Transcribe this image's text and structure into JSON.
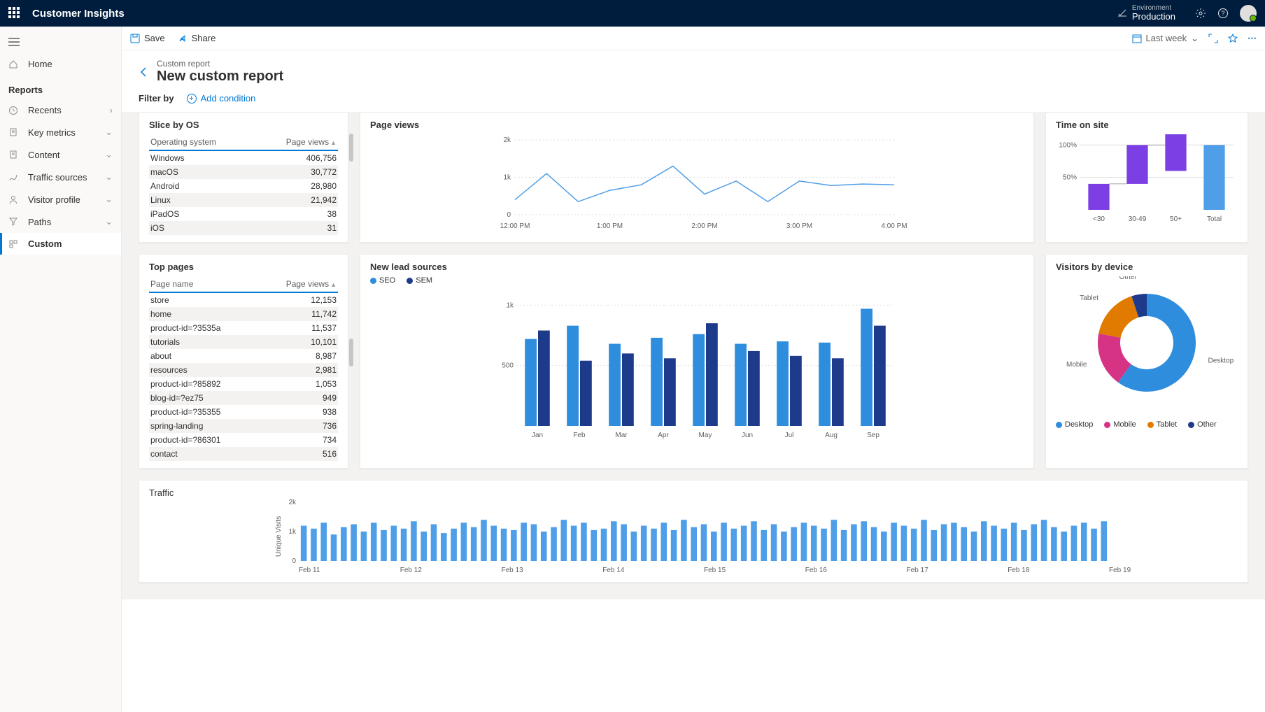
{
  "topbar": {
    "app_title": "Customer Insights",
    "env_label": "Environment",
    "env_value": "Production"
  },
  "sidebar": {
    "home": "Home",
    "section": "Reports",
    "items": [
      {
        "label": "Recents",
        "icon": "clock",
        "chev": "right"
      },
      {
        "label": "Key metrics",
        "icon": "document",
        "chev": "down"
      },
      {
        "label": "Content",
        "icon": "document",
        "chev": "down"
      },
      {
        "label": "Traffic sources",
        "icon": "routes",
        "chev": "down"
      },
      {
        "label": "Visitor profile",
        "icon": "person",
        "chev": "down"
      },
      {
        "label": "Paths",
        "icon": "funnel",
        "chev": "down"
      },
      {
        "label": "Custom",
        "icon": "custom",
        "selected": true
      }
    ]
  },
  "cmdbar": {
    "save": "Save",
    "share": "Share",
    "date_range": "Last week"
  },
  "page": {
    "crumb": "Custom report",
    "title": "New custom report",
    "filter_label": "Filter by",
    "add_condition": "Add condition"
  },
  "cards": {
    "slice_by_os": {
      "title": "Slice by OS",
      "col1": "Operating system",
      "col2": "Page views"
    },
    "page_views": {
      "title": "Page views"
    },
    "time_on_site": {
      "title": "Time on site"
    },
    "top_pages": {
      "title": "Top pages",
      "col1": "Page name",
      "col2": "Page views"
    },
    "new_lead_sources": {
      "title": "New lead sources",
      "legend_seo": "SEO",
      "legend_sem": "SEM"
    },
    "visitors_by_device": {
      "title": "Visitors by device",
      "l_desktop": "Desktop",
      "l_mobile": "Mobile",
      "l_tablet": "Tablet",
      "l_other": "Other"
    },
    "traffic": {
      "title": "Traffic",
      "ylabel": "Unique Visits"
    }
  },
  "chart_data": [
    {
      "id": "slice_by_os",
      "type": "table",
      "columns": [
        "Operating system",
        "Page views"
      ],
      "rows": [
        [
          "Windows",
          406756
        ],
        [
          "macOS",
          30772
        ],
        [
          "Android",
          28980
        ],
        [
          "Linux",
          21942
        ],
        [
          "iPadOS",
          38
        ],
        [
          "iOS",
          31
        ]
      ]
    },
    {
      "id": "page_views",
      "type": "line",
      "title": "Page views",
      "x": [
        "12:00 PM",
        "1:00 PM",
        "2:00 PM",
        "3:00 PM",
        "4:00 PM"
      ],
      "y_ticks": [
        0,
        1000,
        2000
      ],
      "y_tick_labels": [
        "0",
        "1k",
        "2k"
      ],
      "ylim": [
        0,
        2000
      ],
      "series": [
        {
          "name": "Page views",
          "color": "#4f9ee8",
          "values": [
            400,
            1100,
            350,
            650,
            800,
            1300,
            550,
            900,
            350,
            900,
            780,
            820,
            800
          ]
        }
      ]
    },
    {
      "id": "time_on_site",
      "type": "bar",
      "title": "Time on site",
      "categories": [
        "<30",
        "30-49",
        "50+",
        "Total"
      ],
      "y_ticks": [
        50,
        100
      ],
      "y_tick_labels": [
        "50%",
        "100%"
      ],
      "ylim": [
        0,
        110
      ],
      "series": [
        {
          "name": "A",
          "color": "#7b3fe4",
          "values": [
            40,
            60,
            90,
            0
          ]
        },
        {
          "name": "B",
          "color": "#4f9ee8",
          "values": [
            0,
            0,
            0,
            100
          ]
        }
      ],
      "waterfall_bases": [
        0,
        40,
        60,
        0
      ]
    },
    {
      "id": "top_pages",
      "type": "table",
      "columns": [
        "Page name",
        "Page views"
      ],
      "rows": [
        [
          "store",
          12153
        ],
        [
          "home",
          11742
        ],
        [
          "product-id=?3535a",
          11537
        ],
        [
          "tutorials",
          10101
        ],
        [
          "about",
          8987
        ],
        [
          "resources",
          2981
        ],
        [
          "product-id=?85892",
          1053
        ],
        [
          "blog-id=?ez75",
          949
        ],
        [
          "product-id=?35355",
          938
        ],
        [
          "spring-landing",
          736
        ],
        [
          "product-id=?86301",
          734
        ],
        [
          "contact",
          516
        ]
      ]
    },
    {
      "id": "new_lead_sources",
      "type": "bar",
      "title": "New lead sources",
      "categories": [
        "Jan",
        "Feb",
        "Mar",
        "Apr",
        "May",
        "Jun",
        "Jul",
        "Aug",
        "Sep"
      ],
      "y_ticks": [
        500,
        1000
      ],
      "y_tick_labels": [
        "500",
        "1k"
      ],
      "ylim": [
        0,
        1100
      ],
      "series": [
        {
          "name": "SEO",
          "color": "#2f8ddd",
          "values": [
            720,
            830,
            680,
            730,
            760,
            680,
            700,
            690,
            970
          ]
        },
        {
          "name": "SEM",
          "color": "#1e3a8a",
          "values": [
            790,
            540,
            600,
            560,
            850,
            620,
            580,
            560,
            830
          ]
        }
      ]
    },
    {
      "id": "visitors_by_device",
      "type": "pie",
      "title": "Visitors by device",
      "labels": [
        "Desktop",
        "Mobile",
        "Tablet",
        "Other"
      ],
      "values": [
        60,
        18,
        17,
        5
      ],
      "colors": [
        "#2f8ddd",
        "#d63384",
        "#e07b00",
        "#1e3a8a"
      ]
    },
    {
      "id": "traffic",
      "type": "bar",
      "title": "Traffic",
      "ylabel": "Unique Visits",
      "x_ticks": [
        "Feb 11",
        "Feb 12",
        "Feb 13",
        "Feb 14",
        "Feb 15",
        "Feb 16",
        "Feb 17",
        "Feb 18",
        "Feb 19"
      ],
      "y_ticks": [
        0,
        1000,
        2000
      ],
      "y_tick_labels": [
        "0",
        "1k",
        "2k"
      ],
      "ylim": [
        0,
        2000
      ],
      "values": [
        1200,
        1100,
        1300,
        900,
        1150,
        1250,
        1000,
        1300,
        1050,
        1200,
        1100,
        1350,
        1000,
        1250,
        950,
        1100,
        1300,
        1150,
        1400,
        1200,
        1100,
        1050,
        1300,
        1250,
        1000,
        1150,
        1400,
        1200,
        1300,
        1050,
        1100,
        1350,
        1250,
        1000,
        1200,
        1100,
        1300,
        1050,
        1400,
        1150,
        1250,
        1000,
        1300,
        1100,
        1200,
        1350,
        1050,
        1250,
        1000,
        1150,
        1300,
        1200,
        1100,
        1400,
        1050,
        1250,
        1350,
        1150,
        1000,
        1300,
        1200,
        1100,
        1400,
        1050,
        1250,
        1300,
        1150,
        1000,
        1350,
        1200,
        1100,
        1300,
        1050,
        1250,
        1400,
        1150,
        1000,
        1200,
        1300,
        1100,
        1350
      ]
    }
  ]
}
